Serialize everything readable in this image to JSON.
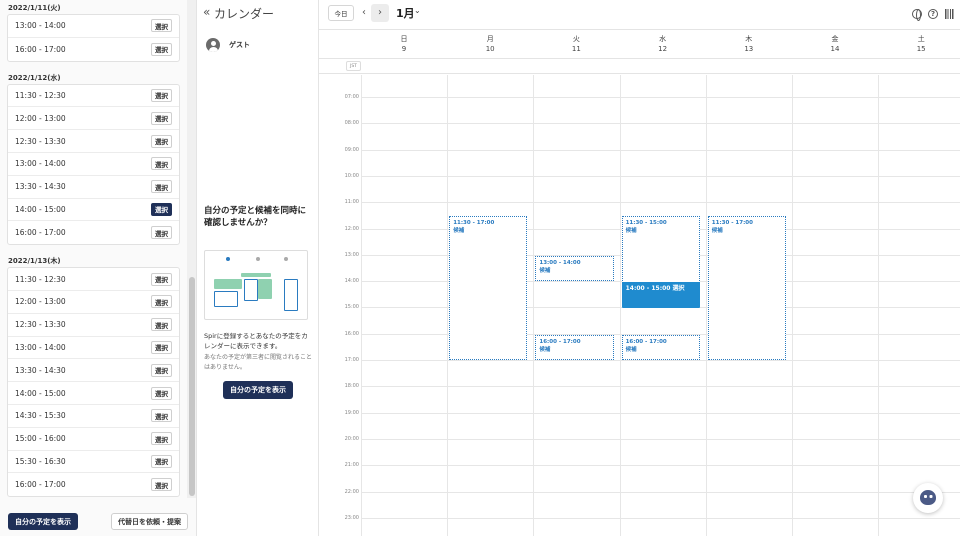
{
  "slot_panel": {
    "groups": [
      {
        "date": "2022/1/11(火)",
        "slots": [
          {
            "time": "13:00 - 14:00",
            "button": "選択"
          },
          {
            "time": "16:00 - 17:00",
            "button": "選択"
          }
        ]
      },
      {
        "date": "2022/1/12(水)",
        "slots": [
          {
            "time": "11:30 - 12:30",
            "button": "選択"
          },
          {
            "time": "12:00 - 13:00",
            "button": "選択"
          },
          {
            "time": "12:30 - 13:30",
            "button": "選択"
          },
          {
            "time": "13:00 - 14:00",
            "button": "選択"
          },
          {
            "time": "13:30 - 14:30",
            "button": "選択"
          },
          {
            "time": "14:00 - 15:00",
            "button": "選択",
            "selected": true
          },
          {
            "time": "16:00 - 17:00",
            "button": "選択"
          }
        ]
      },
      {
        "date": "2022/1/13(木)",
        "slots": [
          {
            "time": "11:30 - 12:30",
            "button": "選択"
          },
          {
            "time": "12:00 - 13:00",
            "button": "選択"
          },
          {
            "time": "12:30 - 13:30",
            "button": "選択"
          },
          {
            "time": "13:00 - 14:00",
            "button": "選択"
          },
          {
            "time": "13:30 - 14:30",
            "button": "選択"
          },
          {
            "time": "14:00 - 15:00",
            "button": "選択"
          },
          {
            "time": "14:30 - 15:30",
            "button": "選択"
          },
          {
            "time": "15:00 - 16:00",
            "button": "選択"
          },
          {
            "time": "15:30 - 16:30",
            "button": "選択"
          },
          {
            "time": "16:00 - 17:00",
            "button": "選択"
          }
        ]
      }
    ],
    "footer": {
      "show_schedule": "自分の予定を表示",
      "request_alternative": "代替日を依頼・提案"
    }
  },
  "info_panel": {
    "collapse_icon": "«",
    "title": "カレンダー",
    "guest_name": "ゲスト",
    "promo_title": "自分の予定と候補を同時に確認しませんか？",
    "promo_text": "Spirに登録するとあなたの予定をカレンダーに表示できます。",
    "promo_note": "あなたの予定が第三者に閲覧されることはありません。",
    "promo_button": "自分の予定を表示"
  },
  "calendar": {
    "today_button": "今日",
    "prev_icon": "‹",
    "next_icon": "›",
    "month": "1月",
    "month_chevron": "⌄",
    "help_icon": "?",
    "timezone": "JST",
    "days": [
      {
        "dow": "日",
        "num": "9"
      },
      {
        "dow": "月",
        "num": "10"
      },
      {
        "dow": "火",
        "num": "11"
      },
      {
        "dow": "水",
        "num": "12"
      },
      {
        "dow": "木",
        "num": "13"
      },
      {
        "dow": "金",
        "num": "14"
      },
      {
        "dow": "土",
        "num": "15"
      }
    ],
    "hours": [
      "07:00",
      "08:00",
      "09:00",
      "10:00",
      "11:00",
      "12:00",
      "13:00",
      "14:00",
      "15:00",
      "16:00",
      "17:00",
      "18:00",
      "19:00",
      "20:00",
      "21:00",
      "22:00",
      "23:00"
    ],
    "events": [
      {
        "day": 1,
        "start": 11.5,
        "end": 17,
        "time": "11:30 - 17:00",
        "label": "候補",
        "selected": false
      },
      {
        "day": 2,
        "start": 13,
        "end": 14,
        "time": "13:00 - 14:00",
        "label": "候補",
        "selected": false
      },
      {
        "day": 2,
        "start": 16,
        "end": 17,
        "time": "16:00 - 17:00",
        "label": "候補",
        "selected": false
      },
      {
        "day": 3,
        "start": 11.5,
        "end": 15,
        "time": "11:30 - 15:00",
        "label": "候補",
        "selected": false
      },
      {
        "day": 3,
        "start": 14,
        "end": 15,
        "time": "14:00 - 15:00 選択",
        "label": "",
        "selected": true
      },
      {
        "day": 3,
        "start": 16,
        "end": 17,
        "time": "16:00 - 17:00",
        "label": "候補",
        "selected": false
      },
      {
        "day": 4,
        "start": 11.5,
        "end": 17,
        "time": "11:30 - 17:00",
        "label": "候補",
        "selected": false
      }
    ]
  },
  "colors": {
    "navy": "#1f3058",
    "accent": "#2a7bc0",
    "selected_event": "#1f8bcf"
  }
}
